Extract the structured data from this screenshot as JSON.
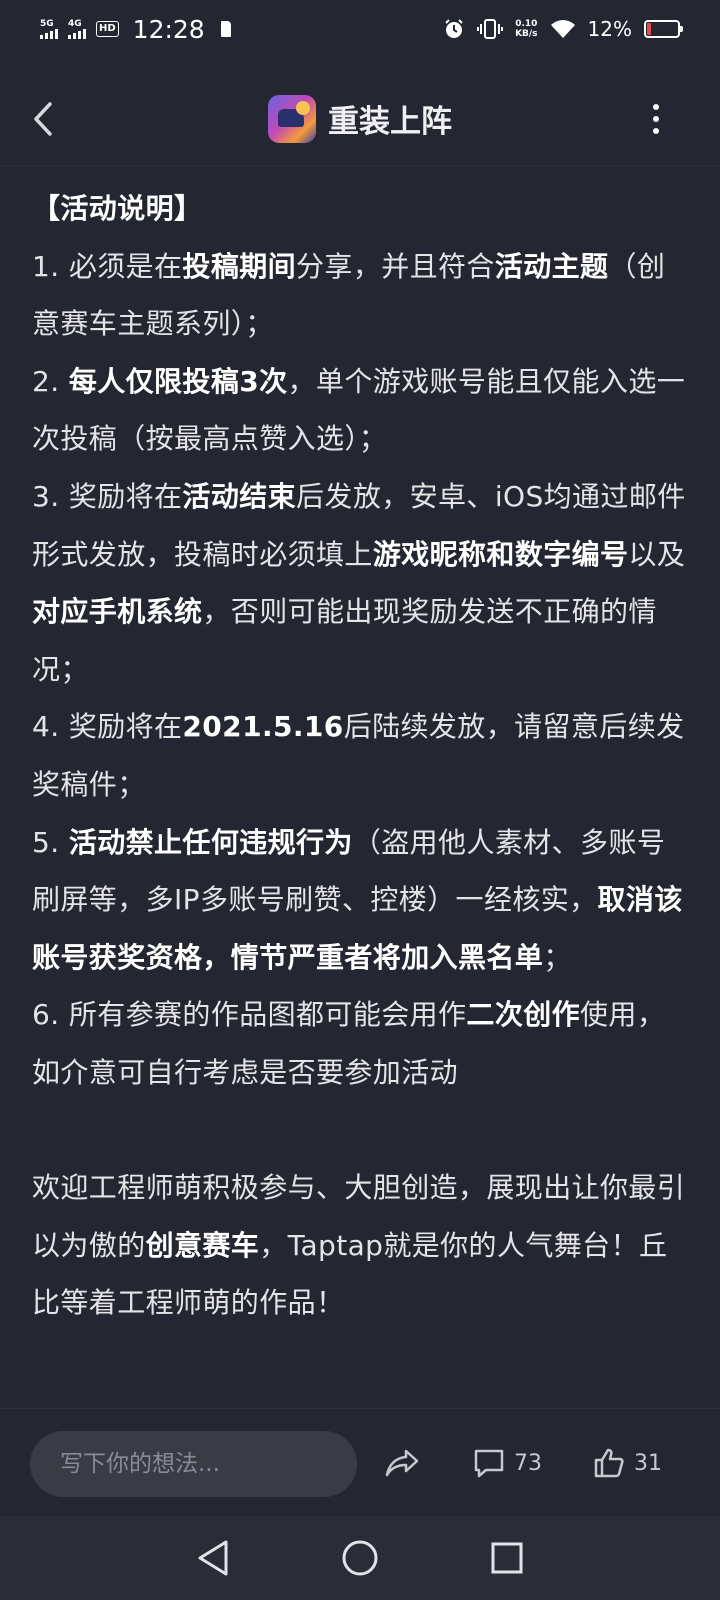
{
  "status_bar": {
    "sim1_label": "5G",
    "sim2_label": "4G",
    "hd_label": "HD",
    "time": "12:28",
    "speed_value": "0.10",
    "speed_unit": "KB/s",
    "battery_percent": "12%",
    "battery_color": "#e84a4a"
  },
  "header": {
    "title": "重装上阵",
    "icons": [
      "back-arrow-icon",
      "app-icon",
      "more-vertical-icon"
    ]
  },
  "article": {
    "section_heading": "【活动说明】",
    "rules": [
      [
        {
          "text": "1. 必须是在",
          "bold": false
        },
        {
          "text": "投稿期间",
          "bold": true
        },
        {
          "text": "分享，并且符合",
          "bold": false
        },
        {
          "text": "活动主题",
          "bold": true
        },
        {
          "text": "（创意赛车主题系列）；",
          "bold": false
        }
      ],
      [
        {
          "text": "2. ",
          "bold": false
        },
        {
          "text": "每人仅限投稿3次",
          "bold": true
        },
        {
          "text": "，单个游戏账号能且仅能入选一次投稿（按最高点赞入选）；",
          "bold": false
        }
      ],
      [
        {
          "text": "3. 奖励将在",
          "bold": false
        },
        {
          "text": "活动结束",
          "bold": true
        },
        {
          "text": "后发放，安卓、iOS均通过邮件形式发放，投稿时必须填上",
          "bold": false
        },
        {
          "text": "游戏昵称和数字编号",
          "bold": true
        },
        {
          "text": "以及",
          "bold": false
        },
        {
          "text": "对应手机系统",
          "bold": true
        },
        {
          "text": "，否则可能出现奖励发送不正确的情况；",
          "bold": false
        }
      ],
      [
        {
          "text": "4. 奖励将在",
          "bold": false
        },
        {
          "text": "2021.5.16",
          "bold": true
        },
        {
          "text": "后陆续发放，请留意后续发奖稿件；",
          "bold": false
        }
      ],
      [
        {
          "text": "5. ",
          "bold": false
        },
        {
          "text": "活动禁止任何违规行为",
          "bold": true
        },
        {
          "text": "（盗用他人素材、多账号刷屏等，多IP多账号刷赞、控楼）一经核实，",
          "bold": false
        },
        {
          "text": "取消该账号获奖资格，情节严重者将加入黑名单",
          "bold": true
        },
        {
          "text": "；",
          "bold": false
        }
      ],
      [
        {
          "text": "6. 所有参赛的作品图都可能会用作",
          "bold": false
        },
        {
          "text": "二次创作",
          "bold": true
        },
        {
          "text": "使用，如介意可自行考虑是否要参加活动",
          "bold": false
        }
      ]
    ],
    "closing": [
      {
        "text": "欢迎工程师萌积极参与、大胆创造，展现出让你最引以为傲的",
        "bold": false
      },
      {
        "text": "创意赛车",
        "bold": true
      },
      {
        "text": "，Taptap",
        "bold": false
      },
      {
        "text": "就是你的人气舞台！丘比等着工程师萌的作品！",
        "bold": false
      }
    ]
  },
  "bottom_bar": {
    "comment_placeholder": "写下你的想法...",
    "comment_count": "73",
    "like_count": "31",
    "icons": [
      "share-icon",
      "comment-icon",
      "thumbs-up-icon"
    ]
  },
  "nav_bar": {
    "icons": [
      "back-triangle-icon",
      "home-circle-icon",
      "recents-square-icon"
    ]
  }
}
